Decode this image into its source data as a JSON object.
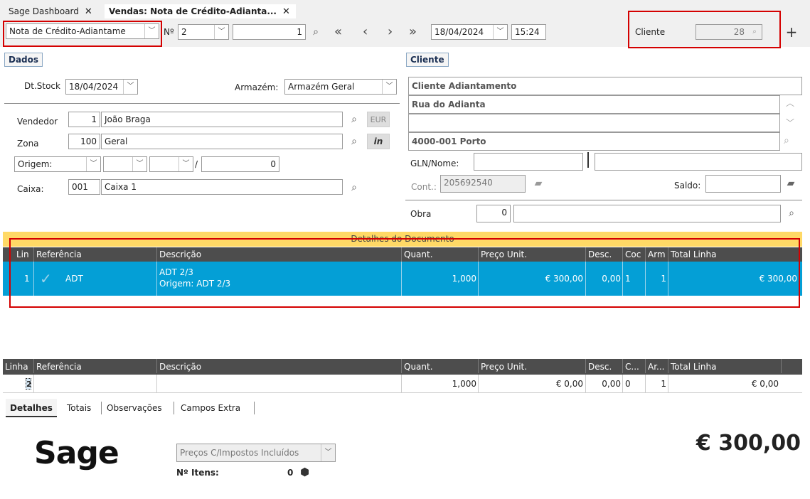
{
  "tabs": [
    {
      "label": "Sage Dashboard",
      "close": "✕"
    },
    {
      "label": "Vendas: Nota de Crédito-Adianta...",
      "close": "✕"
    }
  ],
  "toolbar": {
    "doc_type": "Nota de Crédito-Adiantame",
    "numero_label": "Nº",
    "serie": "2",
    "doc_number": "1",
    "date": "18/04/2024",
    "time": "15:24",
    "cliente_label": "Cliente",
    "cliente_value": "28"
  },
  "dados": {
    "title": "Dados",
    "dt_stock_label": "Dt.Stock",
    "dt_stock": "18/04/2024",
    "armazem_label": "Armazém:",
    "armazem": "Armazém Geral",
    "vendedor_label": "Vendedor",
    "vendedor_code": "1",
    "vendedor_name": "João Braga",
    "currency": "EUR",
    "zona_label": "Zona",
    "zona_code": "100",
    "zona_name": "Geral",
    "origem_label": "Origem:",
    "origem_slash": "/",
    "origem_value": "0",
    "caixa_label": "Caixa:",
    "caixa_code": "001",
    "caixa_name": "Caixa 1"
  },
  "cliente": {
    "title": "Cliente",
    "name": "Cliente Adiantamento",
    "address1": "Rua do Adianta",
    "address2": "",
    "postal": "4000-001 Porto",
    "gln_label": "GLN/Nome:",
    "cont_label": "Cont.:",
    "cont_value": "205692540",
    "saldo_label": "Saldo:",
    "obra_label": "Obra",
    "obra_value": "0"
  },
  "grid": {
    "section_title": "Detalhes do Documento",
    "headers": [
      "Lin",
      "Referência",
      "Descrição",
      "Quant.",
      "Preço Unit.",
      "Desc.",
      "Coc",
      "Arm",
      "Total Linha"
    ],
    "row": {
      "lin": "1",
      "referencia": "ADT",
      "descricao1": "ADT 2/3",
      "descricao2": "Origem: ADT 2/3",
      "quant": "1,000",
      "preco": "€ 300,00",
      "desc": "0,00",
      "coc": "1",
      "arm": "1",
      "total": "€ 300,00"
    }
  },
  "new_line": {
    "headers": [
      "Linha",
      "Referência",
      "Descrição",
      "Quant.",
      "Preço Unit.",
      "Desc.",
      "C...",
      "Ar...",
      "Total Linha"
    ],
    "linha": "2",
    "quant": "1,000",
    "preco": "€ 0,00",
    "desc": "0,00",
    "c": "0",
    "ar": "1",
    "total": "€ 0,00"
  },
  "bottom_tabs": [
    "Detalhes",
    "Totais",
    "Observações",
    "Campos Extra"
  ],
  "footer": {
    "logo": "Sage",
    "precos": "Preços C/Impostos Incluídos",
    "itens_label": "Nº Itens:",
    "itens_value": "0",
    "total": "€ 300,00"
  },
  "colors": {
    "selected_row": "#049fd6",
    "grid_header": "#4d4d4d",
    "highlight": "#d40000",
    "section_band": "#ffd966"
  }
}
